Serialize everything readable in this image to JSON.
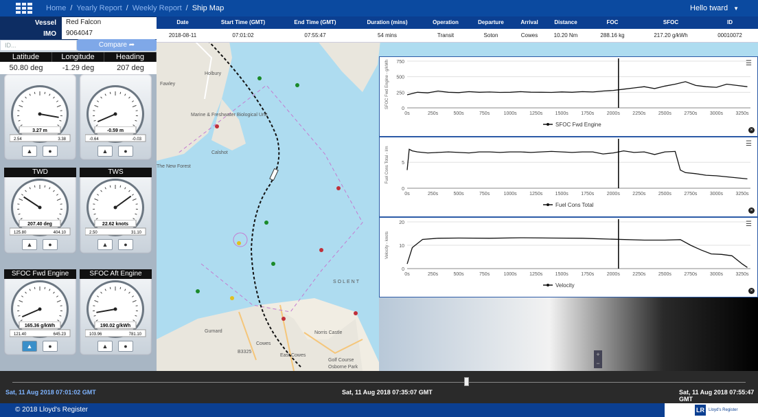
{
  "topbar": {
    "breadcrumbs": [
      "Home",
      "Yearly Report",
      "Weekly Report",
      "Ship Map"
    ],
    "separator": "/",
    "user_greeting": "Hello tward"
  },
  "vessel": {
    "vessel_label": "Vessel",
    "vessel_value": "Red Falcon",
    "imo_label": "IMO",
    "imo_value": "9064047",
    "id_placeholder": "ID...",
    "compare_label": "Compare ➦"
  },
  "position": {
    "headers": [
      "Latitude",
      "Longitude",
      "Heading"
    ],
    "values": [
      "50.80 deg",
      "-1.29 deg",
      "207 deg"
    ]
  },
  "gauges": [
    {
      "title": "",
      "value": "3.27 m",
      "min": "2.54",
      "max": "3.38",
      "needle_frac": 0.87
    },
    {
      "title": "",
      "value": "-0.59 m",
      "min": "-0.64",
      "max": "-0.03",
      "needle_frac": 0.08
    },
    {
      "title": "TWD",
      "value": "207.40 deg",
      "min": "125.80",
      "max": "404.10",
      "needle_frac": 0.29
    },
    {
      "title": "TWS",
      "value": "22.62 knots",
      "min": "2.50",
      "max": "31.10",
      "needle_frac": 0.7
    },
    {
      "title": "SFOC Fwd Engine",
      "value": "165.36 g/kWh",
      "min": "121.40",
      "max": "645.23",
      "needle_frac": 0.08
    },
    {
      "title": "SFOC Aft Engine",
      "value": "190.02 g/kWh",
      "min": "103.96",
      "max": "781.10",
      "needle_frac": 0.13
    }
  ],
  "voyage_table": {
    "columns": [
      "Date",
      "Start Time (GMT)",
      "End Time (GMT)",
      "Duration (mins)",
      "Operation",
      "Departure",
      "Arrival",
      "Distance",
      "FOC",
      "SFOC",
      "ID"
    ],
    "row": [
      "2018-08-11",
      "07:01:02",
      "07:55:47",
      "54 mins",
      "Transit",
      "Soton",
      "Cowes",
      "10.20 Nm",
      "288.16 kg",
      "217.20 g/kWh",
      "00010072"
    ]
  },
  "map": {
    "place_labels": [
      "Fawley",
      "Holbury",
      "Calshot",
      "Marine & Freshwater Biological Unit",
      "The New Forest",
      "Gurnard",
      "Cowes",
      "East Cowes",
      "SOLENT",
      "Norris Castle",
      "Golf Course",
      "Osborne Park",
      "B3325"
    ],
    "zoom_in": "+",
    "zoom_out": "−"
  },
  "chart_data": [
    {
      "type": "line",
      "ylabel": "SFOC Fwd Engine - g/kWh",
      "xlabel": "",
      "legend": "SFOC Fwd Engine",
      "ylim": [
        0,
        750
      ],
      "yticks": [
        0,
        250,
        500,
        750
      ],
      "xticks": [
        "0s",
        "250s",
        "500s",
        "750s",
        "1000s",
        "1250s",
        "1500s",
        "1750s",
        "2000s",
        "2250s",
        "2500s",
        "2750s",
        "3000s",
        "3250s"
      ],
      "cursor_x": 2050,
      "x": [
        0,
        100,
        200,
        300,
        400,
        500,
        600,
        700,
        800,
        900,
        1000,
        1100,
        1200,
        1300,
        1400,
        1500,
        1600,
        1700,
        1800,
        1900,
        2000,
        2100,
        2200,
        2300,
        2400,
        2500,
        2600,
        2700,
        2800,
        2900,
        3000,
        3100,
        3200,
        3300
      ],
      "y": [
        210,
        250,
        240,
        270,
        250,
        245,
        260,
        250,
        255,
        248,
        250,
        260,
        252,
        250,
        248,
        256,
        250,
        260,
        255,
        270,
        280,
        300,
        320,
        340,
        310,
        350,
        380,
        420,
        360,
        340,
        330,
        380,
        360,
        340
      ]
    },
    {
      "type": "line",
      "ylabel": "Fuel Cons Total - l/m",
      "xlabel": "",
      "legend": "Fuel Cons Total",
      "ylim": [
        0,
        9
      ],
      "yticks": [
        0,
        5
      ],
      "xticks": [
        "0s",
        "250s",
        "500s",
        "750s",
        "1000s",
        "1250s",
        "1500s",
        "1750s",
        "2000s",
        "2250s",
        "2500s",
        "2750s",
        "3000s",
        "3250s"
      ],
      "cursor_x": 2050,
      "x": [
        0,
        20,
        50,
        100,
        200,
        300,
        400,
        500,
        600,
        700,
        800,
        900,
        1000,
        1100,
        1200,
        1300,
        1400,
        1500,
        1600,
        1700,
        1800,
        1900,
        2000,
        2100,
        2200,
        2300,
        2400,
        2500,
        2600,
        2650,
        2700,
        2800,
        2900,
        3000,
        3100,
        3200,
        3300
      ],
      "y": [
        3.5,
        7.5,
        7.2,
        7.0,
        6.8,
        6.9,
        7.0,
        6.9,
        6.8,
        7.0,
        7.0,
        6.9,
        7.0,
        7.0,
        6.9,
        7.0,
        7.1,
        7.0,
        6.9,
        7.0,
        7.0,
        6.6,
        6.8,
        7.2,
        6.9,
        7.0,
        6.5,
        7.0,
        7.1,
        3.5,
        3.0,
        2.8,
        2.5,
        2.4,
        2.2,
        2.0,
        1.8
      ]
    },
    {
      "type": "line",
      "ylabel": "Velocity - knots",
      "xlabel": "",
      "legend": "Velocity",
      "ylim": [
        0,
        20
      ],
      "yticks": [
        0,
        10,
        20
      ],
      "xticks": [
        "0s",
        "250s",
        "500s",
        "750s",
        "1000s",
        "1250s",
        "1500s",
        "1750s",
        "2000s",
        "2250s",
        "2500s",
        "2750s",
        "3000s",
        "3250s"
      ],
      "cursor_x": 2050,
      "x": [
        0,
        50,
        150,
        300,
        500,
        800,
        1100,
        1400,
        1700,
        2000,
        2300,
        2500,
        2650,
        2750,
        2850,
        2950,
        3050,
        3150,
        3250,
        3300
      ],
      "y": [
        2,
        9,
        12.5,
        13,
        13.1,
        13,
        13.2,
        13.1,
        13,
        12.6,
        12.2,
        12.2,
        12.4,
        10,
        8,
        6.3,
        6.1,
        5.5,
        2,
        0.5
      ]
    }
  ],
  "timeline": {
    "start": "Sat, 11 Aug 2018 07:01:02 GMT",
    "current": "Sat, 11 Aug 2018 07:35:07 GMT",
    "end": "Sat, 11 Aug 2018 07:55:47 GMT",
    "position_frac": 0.62
  },
  "footer": {
    "copyright": "© 2018 Lloyd's Register",
    "logo_letters": "LR",
    "logo_text": "Lloyd's Register"
  },
  "colors": {
    "brand_blue": "#0b3f91",
    "topbar_blue": "#0b4aa0",
    "sea": "#aedcf0",
    "route": "#000000"
  }
}
